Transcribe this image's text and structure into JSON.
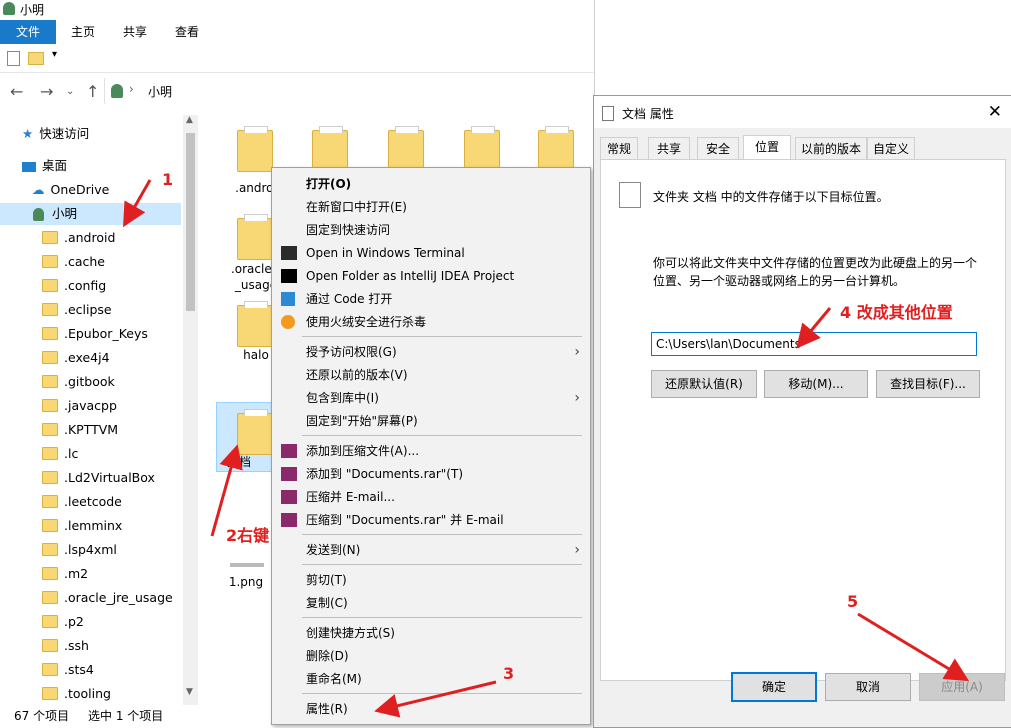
{
  "explorer": {
    "title": "小明",
    "ribbon_tabs": [
      "文件",
      "主页",
      "共享",
      "查看"
    ],
    "breadcrumb": "小明",
    "sidebar": {
      "quick_access": "快速访问",
      "desktop": "桌面",
      "onedrive": "OneDrive",
      "user": "小明",
      "folders": [
        ".android",
        ".cache",
        ".config",
        ".eclipse",
        ".Epubor_Keys",
        ".exe4j4",
        ".gitbook",
        ".javacpp",
        ".KPTTVM",
        ".lc",
        ".Ld2VirtualBox",
        ".leetcode",
        ".lemminx",
        ".lsp4xml",
        ".m2",
        ".oracle_jre_usage",
        ".p2",
        ".ssh",
        ".sts4",
        ".tooling"
      ]
    },
    "content_items": [
      ".androi",
      ".oracle_j\n_usage",
      "halo",
      "文档",
      "1.png"
    ],
    "status_count": "67 个项目",
    "status_selected": "选中 1 个项目"
  },
  "context_menu": {
    "items": [
      "打开(O)",
      "在新窗口中打开(E)",
      "固定到快速访问",
      "Open in Windows Terminal",
      "Open Folder as IntelliJ IDEA Project",
      "通过 Code 打开",
      "使用火绒安全进行杀毒",
      "授予访问权限(G)",
      "还原以前的版本(V)",
      "包含到库中(I)",
      "固定到\"开始\"屏幕(P)",
      "添加到压缩文件(A)...",
      "添加到 \"Documents.rar\"(T)",
      "压缩并 E-mail...",
      "压缩到 \"Documents.rar\" 并 E-mail",
      "发送到(N)",
      "剪切(T)",
      "复制(C)",
      "创建快捷方式(S)",
      "删除(D)",
      "重命名(M)",
      "属性(R)"
    ]
  },
  "dialog": {
    "title": "文档 属性",
    "tabs": [
      "常规",
      "共享",
      "安全",
      "位置",
      "以前的版本",
      "自定义"
    ],
    "heading": "文件夹 文档 中的文件存储于以下目标位置。",
    "description_line1": "你可以将此文件夹中文件存储的位置更改为此硬盘上的另一个",
    "description_line2": "位置、另一个驱动器或网络上的另一台计算机。",
    "path": "C:\\Users\\lan\\Documents",
    "restore_label": "还原默认值(R)",
    "move_label": "移动(M)...",
    "find_label": "查找目标(F)...",
    "ok_label": "确定",
    "cancel_label": "取消",
    "apply_label": "应用(A)"
  },
  "annotations": {
    "a1": "1",
    "a2": "2右键",
    "a3": "3",
    "a4": "4 改成其他位置",
    "a5": "5",
    "color": "#e02020"
  }
}
